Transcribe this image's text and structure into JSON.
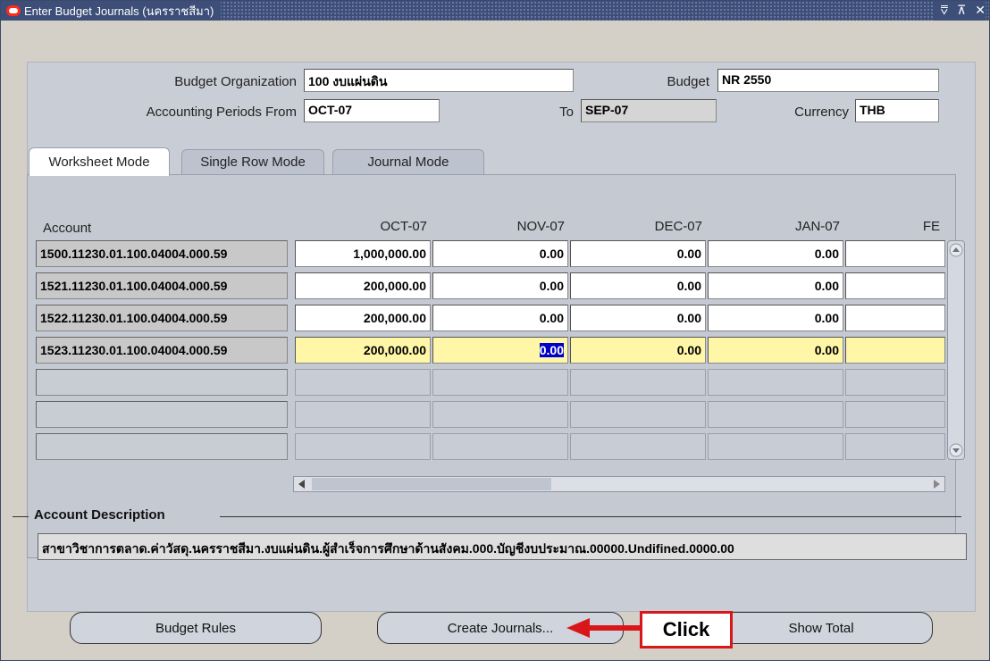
{
  "window": {
    "title": "Enter Budget Journals (นครราชสีมา)",
    "controls": [
      "⩢",
      "⊼",
      "✕"
    ]
  },
  "header": {
    "budget_org_label": "Budget Organization",
    "budget_org_value": "100 งบแผ่นดิน",
    "budget_label": "Budget",
    "budget_value": "NR 2550",
    "periods_from_label": "Accounting Periods From",
    "periods_from_value": "OCT-07",
    "to_label": "To",
    "to_value": "SEP-07",
    "currency_label": "Currency",
    "currency_value": "THB"
  },
  "tabs": [
    {
      "label": "Worksheet Mode",
      "active": true
    },
    {
      "label": "Single Row Mode",
      "active": false
    },
    {
      "label": "Journal Mode",
      "active": false
    }
  ],
  "grid": {
    "account_header": "Account",
    "columns": [
      "OCT-07",
      "NOV-07",
      "DEC-07",
      "JAN-07",
      "FE"
    ],
    "rows": [
      {
        "account": "1500.11230.01.100.04004.000.59",
        "values": [
          "1,000,000.00",
          "0.00",
          "0.00",
          "0.00",
          ""
        ]
      },
      {
        "account": "1521.11230.01.100.04004.000.59",
        "values": [
          "200,000.00",
          "0.00",
          "0.00",
          "0.00",
          ""
        ]
      },
      {
        "account": "1522.11230.01.100.04004.000.59",
        "values": [
          "200,000.00",
          "0.00",
          "0.00",
          "0.00",
          ""
        ]
      },
      {
        "account": "1523.11230.01.100.04004.000.59",
        "values": [
          "200,000.00",
          "0.00",
          "0.00",
          "0.00",
          ""
        ]
      }
    ]
  },
  "description": {
    "legend": "Account Description",
    "value": "สาขาวิชาการตลาด.ค่าวัสดุ.นครราชสีมา.งบแผ่นดิน.ผู้สำเร็จการศึกษาด้านสังคม.000.บัญชีงบประมาณ.00000.Undifined.0000.00"
  },
  "buttons": {
    "budget_rules": "Budget Rules",
    "create_journals": "Create Journals...",
    "show_total": "Show Total"
  },
  "annotation": {
    "label": "Click",
    "color": "#d9161a"
  }
}
